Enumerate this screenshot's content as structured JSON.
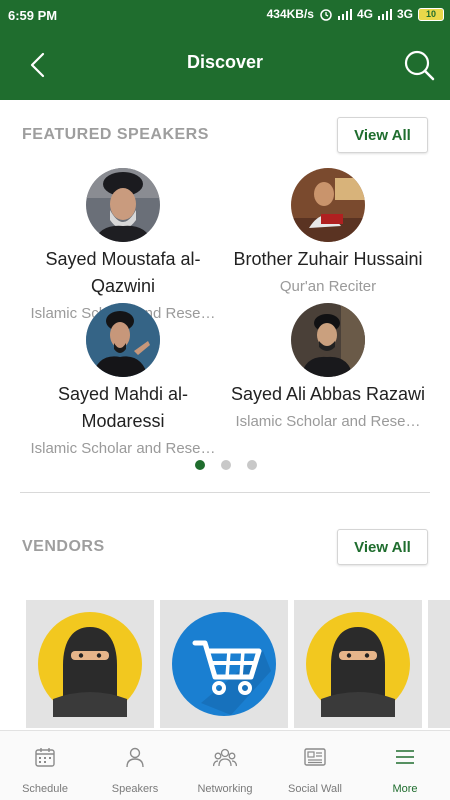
{
  "status_bar": {
    "time": "6:59 PM",
    "network_speed": "434KB/s",
    "network_type_1": "4G",
    "network_type_2": "3G",
    "battery": "10"
  },
  "appbar": {
    "title": "Discover",
    "back_icon": "chevron-left-icon",
    "search_icon": "search-icon"
  },
  "featured_speakers": {
    "title": "FEATURED SPEAKERS",
    "view_all": "View All",
    "items": [
      {
        "name": "Sayed Moustafa al-Qazwini",
        "role": "Islamic Scholar and Rese…"
      },
      {
        "name": "Brother Zuhair Hussaini",
        "role": "Qur'an Reciter"
      },
      {
        "name": "Sayed Mahdi al-Modaressi",
        "role": "Islamic Scholar and Rese…"
      },
      {
        "name": "Sayed Ali Abbas Razawi",
        "role": "Islamic Scholar and Rese…"
      }
    ],
    "page_count": 3,
    "active_page": 1
  },
  "vendors": {
    "title": "VENDORS",
    "view_all": "View All",
    "items": [
      {
        "icon": "niqab-avatar-icon"
      },
      {
        "icon": "shopping-cart-icon"
      },
      {
        "icon": "niqab-avatar-icon"
      }
    ]
  },
  "bottom_nav": [
    {
      "label": "Schedule",
      "icon": "calendar-icon",
      "active": false
    },
    {
      "label": "Speakers",
      "icon": "person-icon",
      "active": false
    },
    {
      "label": "Networking",
      "icon": "people-group-icon",
      "active": false
    },
    {
      "label": "Social Wall",
      "icon": "news-board-icon",
      "active": false
    },
    {
      "label": "More",
      "icon": "menu-icon",
      "active": true
    }
  ],
  "colors": {
    "primary": "#1f6d2e",
    "section_title": "#9e9e9e",
    "vendor_bg": "#e3e3e3",
    "avatar_yellow": "#f2c81f",
    "cart_blue": "#1a7fd1"
  }
}
